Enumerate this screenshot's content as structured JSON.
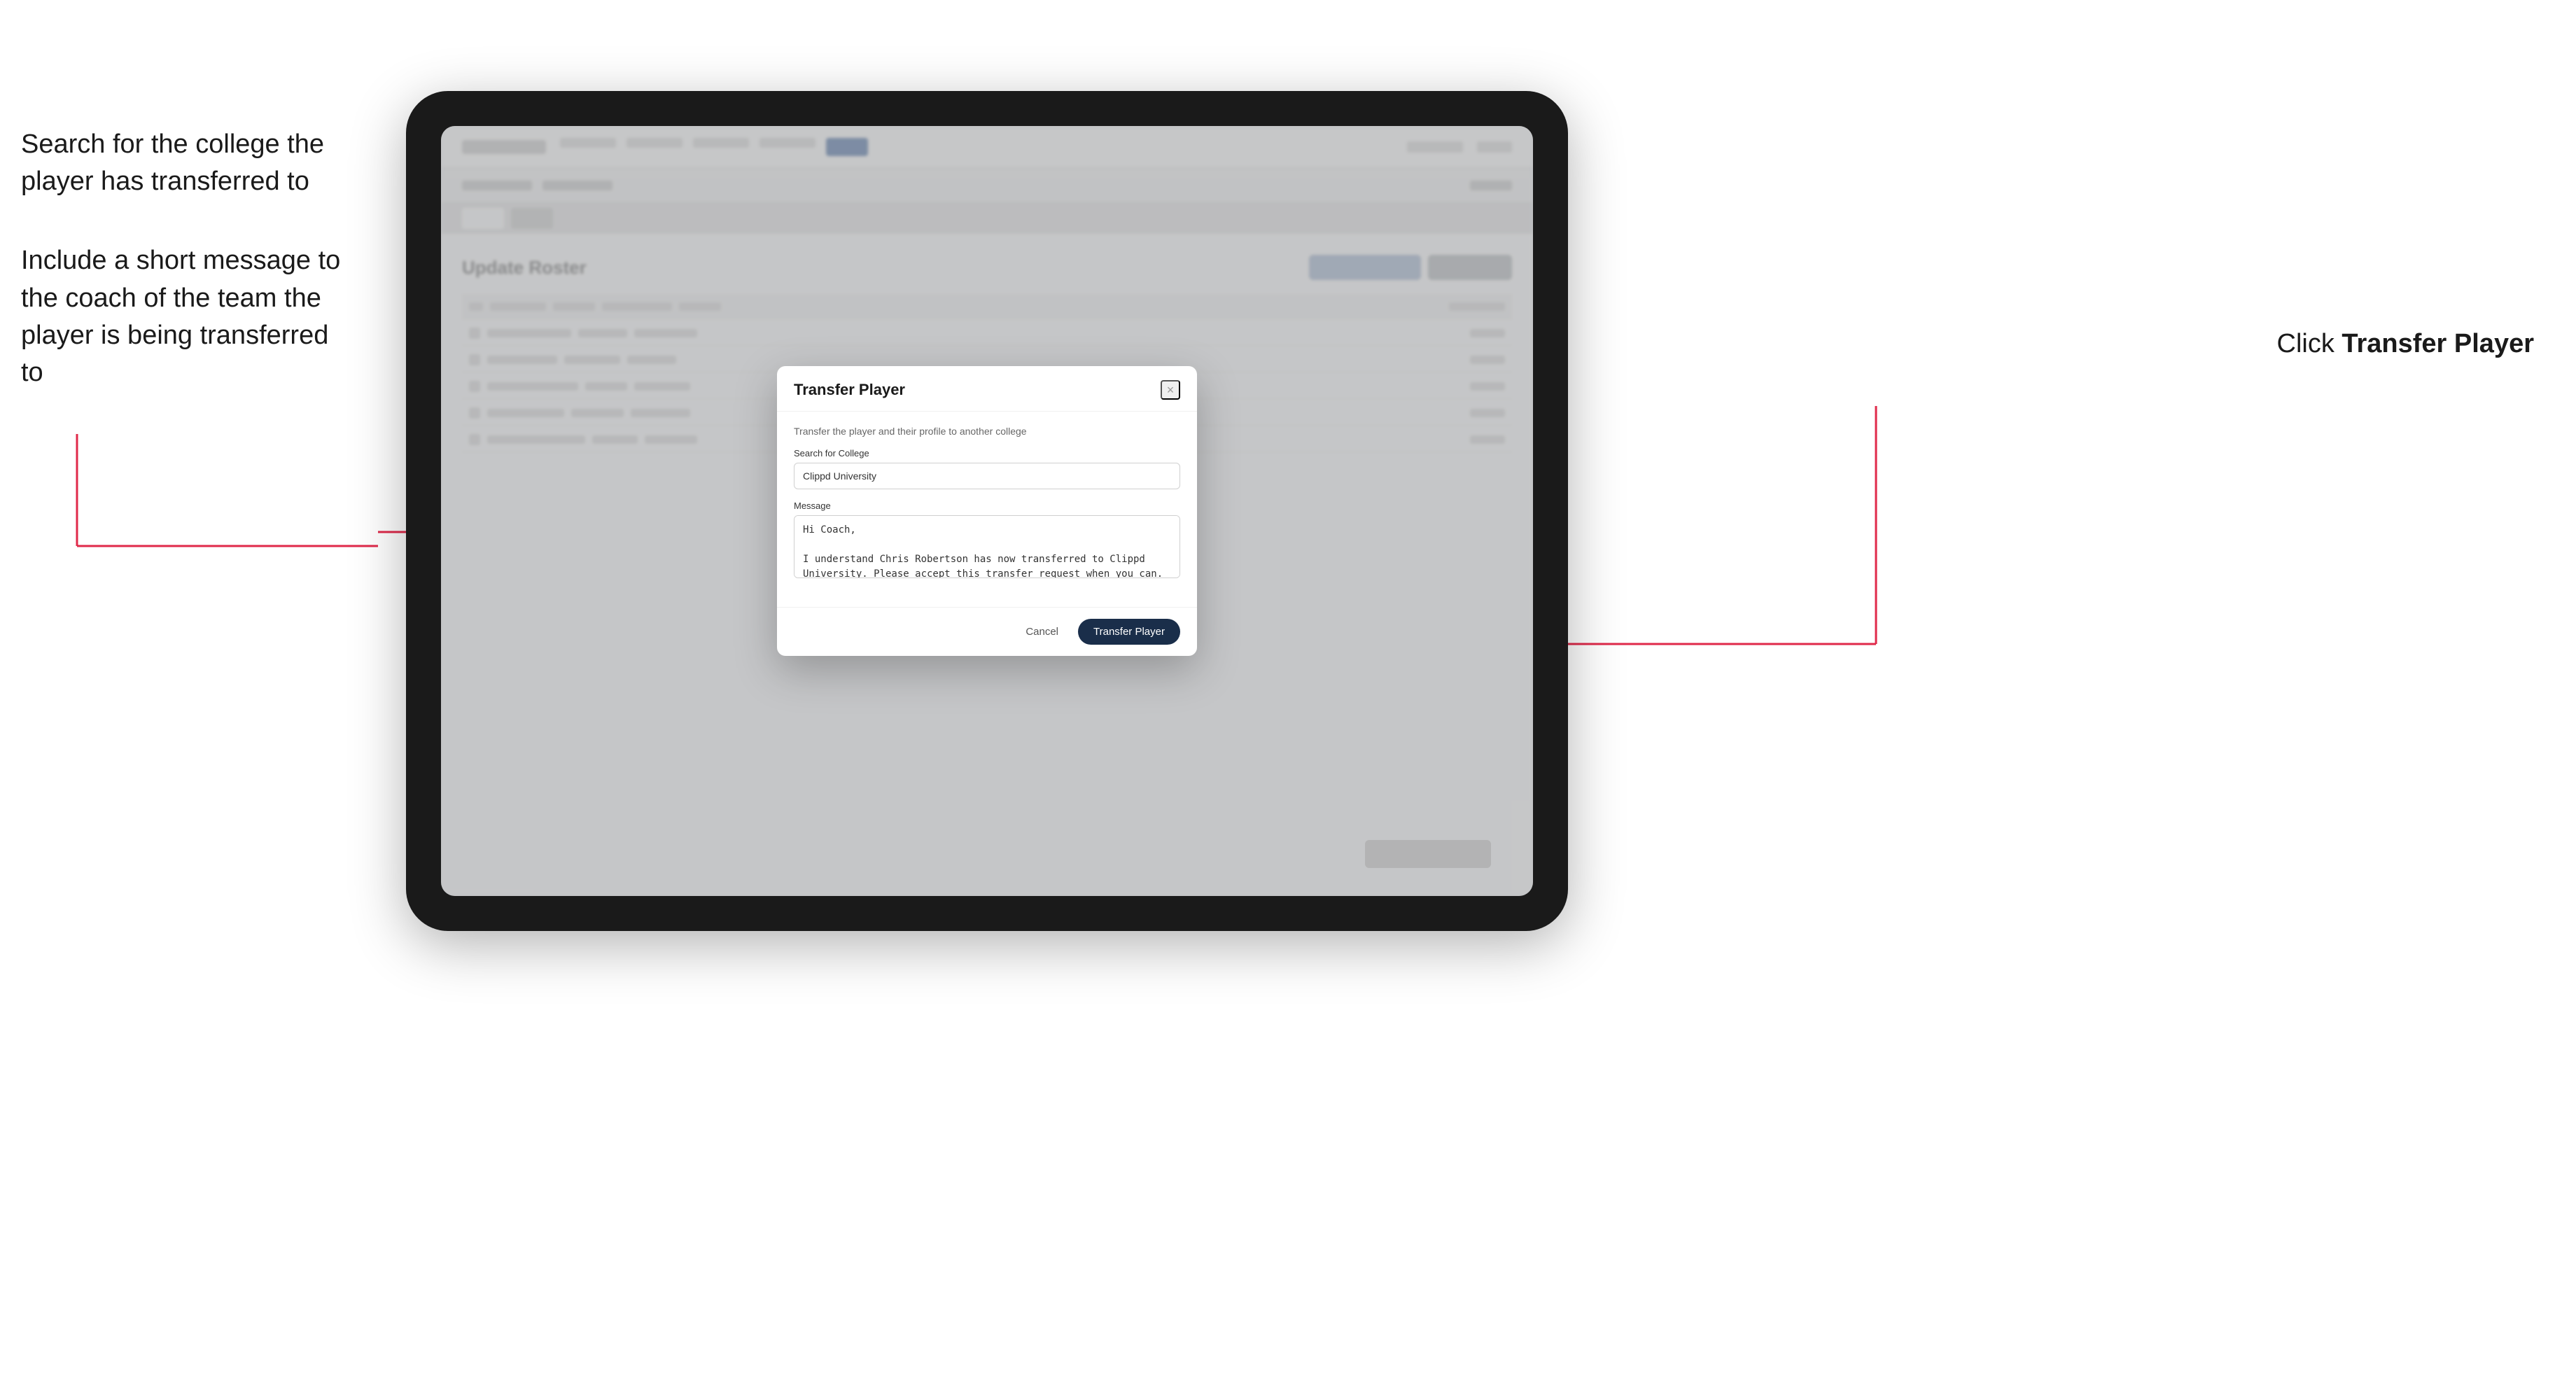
{
  "annotations": {
    "left_line1": "Search for the college the player has transferred to",
    "left_line2": "Include a short message to the coach of the team the player is being transferred to",
    "right_text_prefix": "Click ",
    "right_text_bold": "Transfer Player"
  },
  "modal": {
    "title": "Transfer Player",
    "description": "Transfer the player and their profile to another college",
    "search_label": "Search for College",
    "search_value": "Clippd University",
    "message_label": "Message",
    "message_value": "Hi Coach,\n\nI understand Chris Robertson has now transferred to Clippd University. Please accept this transfer request when you can.",
    "cancel_label": "Cancel",
    "transfer_label": "Transfer Player",
    "close_icon": "×"
  },
  "background": {
    "page_title": "Update Roster"
  }
}
